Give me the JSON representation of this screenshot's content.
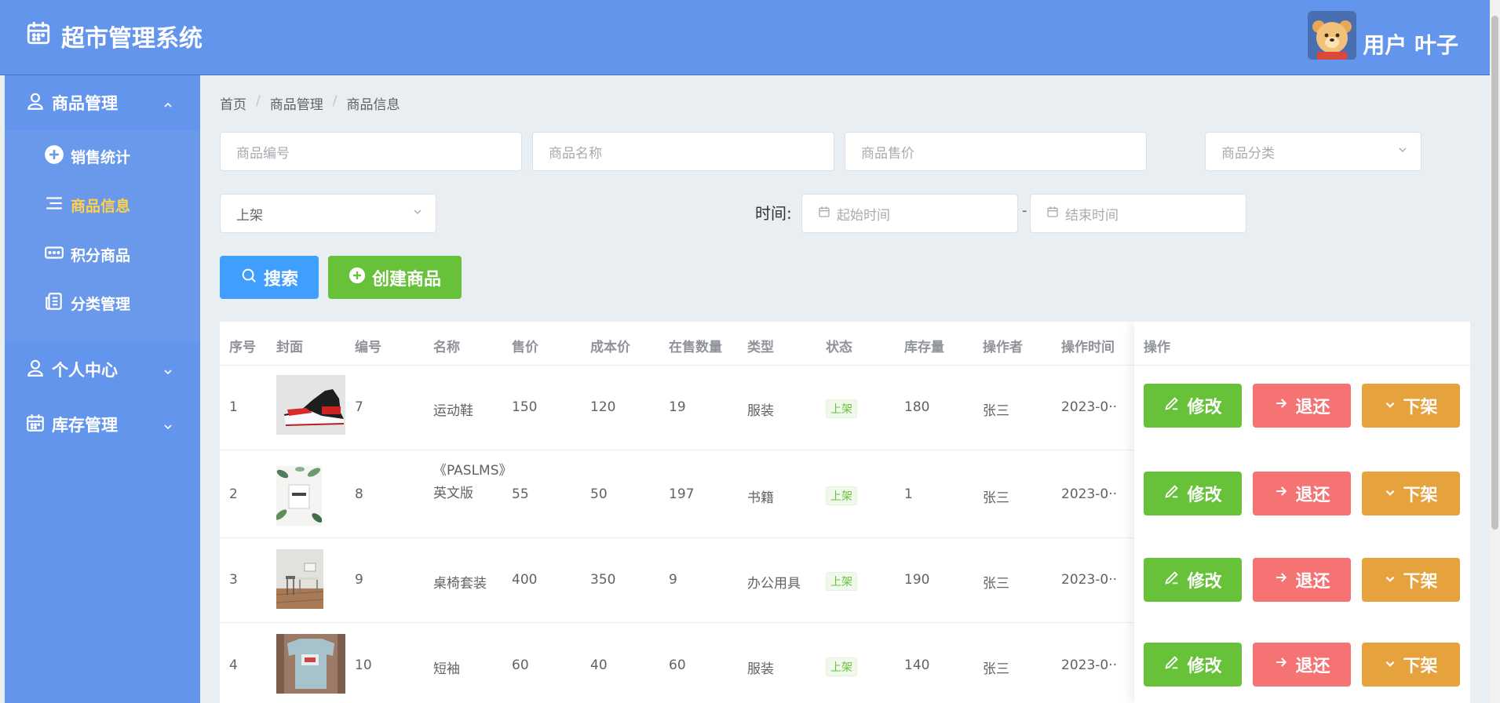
{
  "header": {
    "title": "超市管理系统",
    "user_label": "用户 叶子"
  },
  "sidebar": {
    "groups": [
      {
        "label": "商品管理",
        "expanded": true
      },
      {
        "label": "个人中心",
        "expanded": false
      },
      {
        "label": "库存管理",
        "expanded": false
      }
    ],
    "sub_items": [
      {
        "label": "销售统计",
        "icon": "plus-circle-icon"
      },
      {
        "label": "商品信息",
        "icon": "list-icon",
        "active": true
      },
      {
        "label": "积分商品",
        "icon": "ticket-icon"
      },
      {
        "label": "分类管理",
        "icon": "document-icon"
      }
    ]
  },
  "breadcrumb": [
    "首页",
    "商品管理",
    "商品信息"
  ],
  "filters": {
    "code_placeholder": "商品编号",
    "name_placeholder": "商品名称",
    "price_placeholder": "商品售价",
    "category_placeholder": "商品分类",
    "status_value": "上架",
    "time_label": "时间:",
    "start_placeholder": "起始时间",
    "range_separator": "-",
    "end_placeholder": "结束时间"
  },
  "actions": {
    "search": "搜索",
    "create": "创建商品"
  },
  "table": {
    "headers": [
      "序号",
      "封面",
      "编号",
      "名称",
      "售价",
      "成本价",
      "在售数量",
      "类型",
      "状态",
      "库存量",
      "操作者",
      "操作时间",
      "操作"
    ],
    "rows": [
      {
        "index": "1",
        "code": "7",
        "name": "运动鞋",
        "price": "150",
        "cost": "120",
        "on_sale": "19",
        "type": "服装",
        "status": "上架",
        "stock": "180",
        "operator": "张三",
        "time": "2023-0··"
      },
      {
        "index": "2",
        "code": "8",
        "name": "《PASLMS》英文版",
        "price": "55",
        "cost": "50",
        "on_sale": "197",
        "type": "书籍",
        "status": "上架",
        "stock": "1",
        "operator": "张三",
        "time": "2023-0··"
      },
      {
        "index": "3",
        "code": "9",
        "name": "桌椅套装",
        "price": "400",
        "cost": "350",
        "on_sale": "9",
        "type": "办公用具",
        "status": "上架",
        "stock": "190",
        "operator": "张三",
        "time": "2023-0··"
      },
      {
        "index": "4",
        "code": "10",
        "name": "短袖",
        "price": "60",
        "cost": "40",
        "on_sale": "60",
        "type": "服装",
        "status": "上架",
        "stock": "140",
        "operator": "张三",
        "time": "2023-0··"
      }
    ],
    "row_actions": {
      "edit": "修改",
      "return": "退还",
      "down": "下架"
    }
  },
  "colors": {
    "brand": "#6495ed",
    "primary": "#409eff",
    "success": "#67c23a",
    "danger": "#f56c6c",
    "warning": "#e6a23c",
    "active_menu": "#ffd04b"
  }
}
